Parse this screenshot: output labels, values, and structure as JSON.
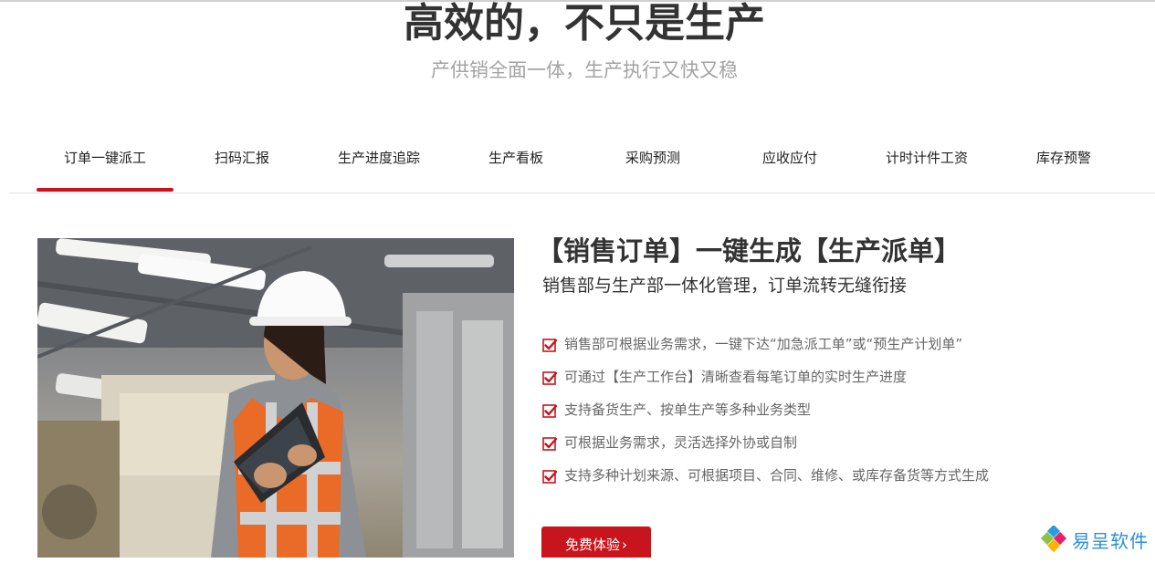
{
  "hero": {
    "title": "高效的，不只是生产",
    "subtitle": "产供销全面一体，生产执行又快又稳"
  },
  "tabs": [
    {
      "label": "订单一键派工",
      "active": true
    },
    {
      "label": "扫码汇报",
      "active": false
    },
    {
      "label": "生产进度追踪",
      "active": false
    },
    {
      "label": "生产看板",
      "active": false
    },
    {
      "label": "采购预测",
      "active": false
    },
    {
      "label": "应收应付",
      "active": false
    },
    {
      "label": "计时计件工资",
      "active": false
    },
    {
      "label": "库存预警",
      "active": false
    }
  ],
  "content": {
    "title": "【销售订单】一键生成【生产派单】",
    "subtitle": "销售部与生产部一体化管理，订单流转无缝衔接",
    "features": [
      "销售部可根据业务需求，一键下达“加急派工单”或“预生产计划单”",
      "可通过【生产工作台】清晰查看每笔订单的实时生产进度",
      "支持备货生产、按单生产等多种业务类型",
      "可根据业务需求，灵活选择外协或自制",
      "支持多种计划来源、可根据项目、合同、维修、或库存备货等方式生成"
    ],
    "cta_label": "免费体验",
    "cta_arrow": "›"
  },
  "brand": {
    "name": "易呈软件"
  },
  "colors": {
    "accent": "#c8151d",
    "brand_blue": "#2b8fd8",
    "title": "#333333",
    "muted": "#a3a3a3"
  },
  "icons": {
    "feature": "checkbox-check-icon",
    "brand": "diamond-logo-icon"
  }
}
